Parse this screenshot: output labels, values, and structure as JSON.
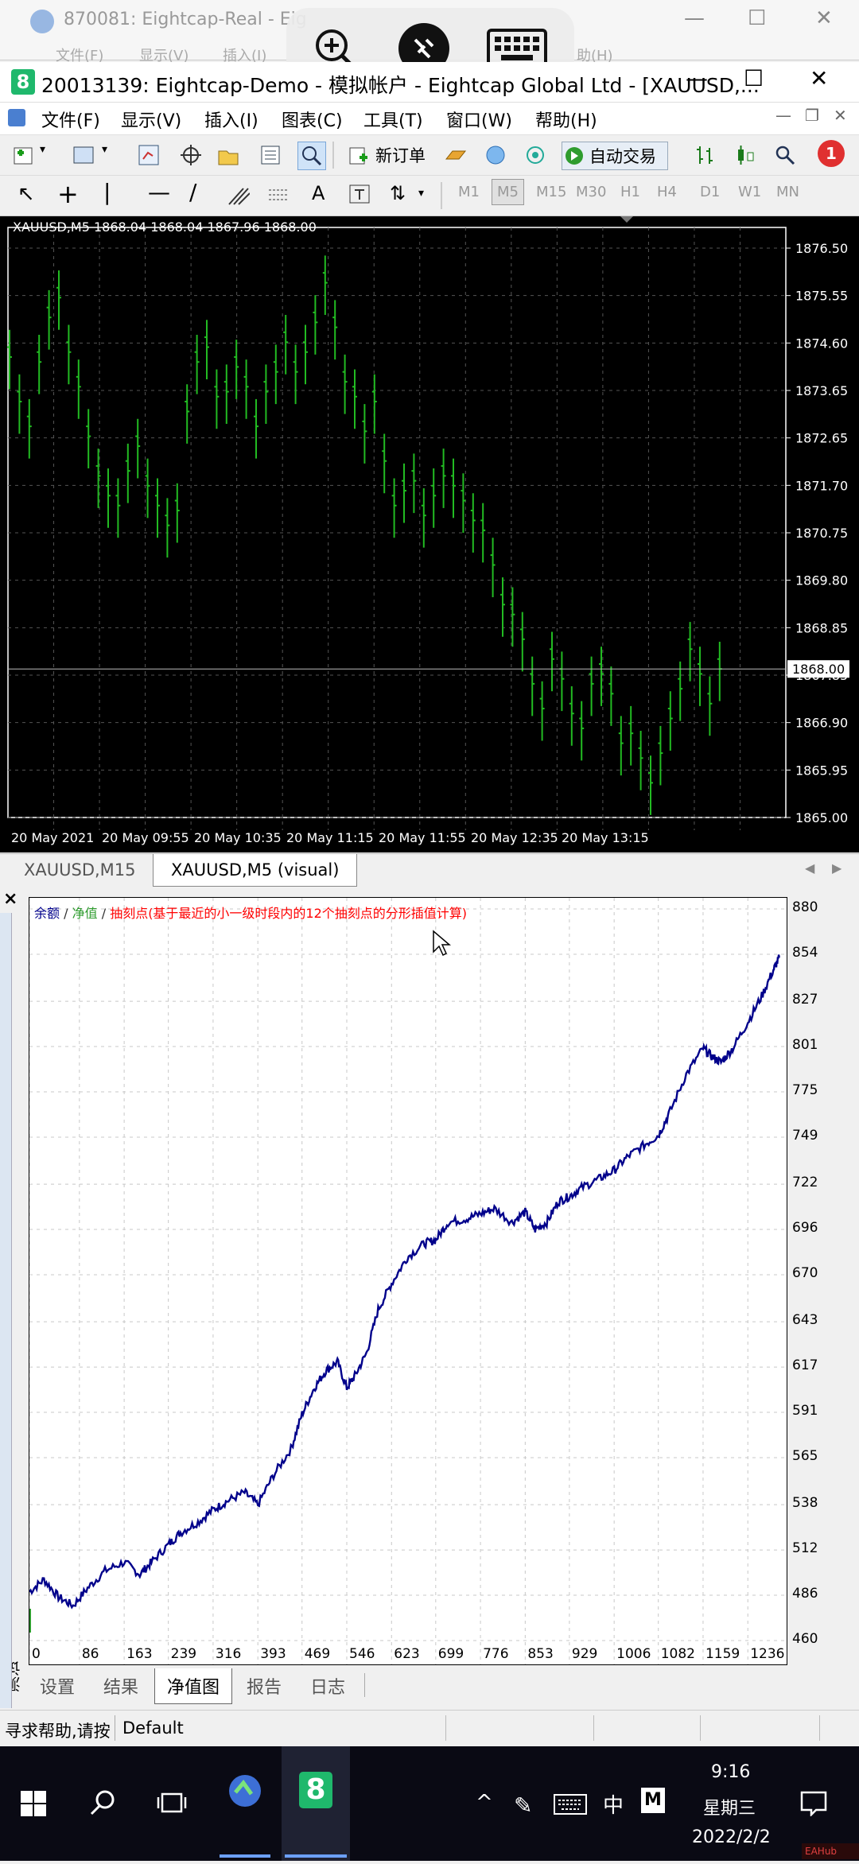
{
  "background_window": {
    "title": "870081: Eightcap-Real - Eig",
    "menu_partial": [
      "文件(F)",
      "显示(V)",
      "插入(I)",
      "助(H)"
    ]
  },
  "window": {
    "title": "20013139: Eightcap-Demo - 模拟帐户 - Eightcap Global Ltd - [XAUUSD,..."
  },
  "menu": [
    "文件(F)",
    "显示(V)",
    "插入(I)",
    "图表(C)",
    "工具(T)",
    "窗口(W)",
    "帮助(H)"
  ],
  "toolbar": {
    "new_order": "新订单",
    "auto_trading": "自动交易",
    "alert_count": "1"
  },
  "timeframes": [
    "M1",
    "M5",
    "M15",
    "M30",
    "H1",
    "H4",
    "D1",
    "W1",
    "MN"
  ],
  "price_chart": {
    "info": "XAUUSD,M5  1868.04 1868.04 1867.96 1868.00",
    "current_price": "1868.00",
    "price_labels": [
      "1876.50",
      "1875.55",
      "1874.60",
      "1873.65",
      "1872.65",
      "1871.70",
      "1870.75",
      "1869.80",
      "1868.85",
      "1867.85",
      "1866.90",
      "1865.95",
      "1865.00"
    ],
    "time_labels": [
      "20 May 2021",
      "20 May 09:55",
      "20 May 10:35",
      "20 May 11:15",
      "20 May 11:55",
      "20 May 12:35",
      "20 May 13:15"
    ],
    "colors": {
      "background": "#000000",
      "candle": "#22bb22",
      "grid": "#555555"
    }
  },
  "chart_tabs": [
    {
      "label": "XAUUSD,M15",
      "active": false
    },
    {
      "label": "XAUUSD,M5 (visual)",
      "active": true
    }
  ],
  "chart_data": {
    "type": "line",
    "legend": {
      "balance": "余额",
      "equity": "净值",
      "ticks": "抽刻点(基于最近的小一级时段内的12个抽刻点的分形插值计算)"
    },
    "x_ticks": [
      "0",
      "86",
      "163",
      "239",
      "316",
      "393",
      "469",
      "546",
      "623",
      "699",
      "776",
      "853",
      "929",
      "1006",
      "1082",
      "1159",
      "1236"
    ],
    "y_ticks": [
      "880",
      "854",
      "827",
      "801",
      "775",
      "749",
      "722",
      "696",
      "670",
      "643",
      "617",
      "591",
      "565",
      "538",
      "512",
      "486",
      "460"
    ],
    "xlim": [
      0,
      1300
    ],
    "ylim": [
      460,
      880
    ],
    "series": [
      {
        "x": [
          0,
          25,
          50,
          75,
          100,
          130,
          163,
          190,
          210,
          239,
          260,
          290,
          316,
          340,
          370,
          393,
          420,
          450,
          469,
          490,
          510,
          530,
          546,
          560,
          580,
          600,
          623,
          650,
          680,
          699,
          720,
          750,
          776,
          800,
          830,
          853,
          870,
          890,
          910,
          929,
          950,
          980,
          1006,
          1030,
          1060,
          1082,
          1100,
          1130,
          1159,
          1175,
          1190,
          1210,
          1236,
          1260,
          1280,
          1290
        ],
        "y": [
          488,
          495,
          485,
          480,
          490,
          500,
          505,
          498,
          505,
          515,
          522,
          528,
          535,
          540,
          545,
          538,
          555,
          570,
          590,
          605,
          615,
          620,
          605,
          612,
          625,
          650,
          665,
          680,
          688,
          690,
          700,
          702,
          705,
          708,
          700,
          706,
          696,
          700,
          712,
          715,
          720,
          725,
          730,
          738,
          745,
          750,
          762,
          785,
          800,
          795,
          792,
          800,
          815,
          830,
          845,
          852
        ]
      }
    ],
    "colors": {
      "balance": "#00008b",
      "equity": "#2e9c2e",
      "ticks": "#ff0000"
    }
  },
  "tester_tabs": [
    {
      "label": "设置",
      "active": false
    },
    {
      "label": "结果",
      "active": false
    },
    {
      "label": "净值图",
      "active": true
    },
    {
      "label": "报告",
      "active": false
    },
    {
      "label": "日志",
      "active": false
    }
  ],
  "tester_side_label": "测试",
  "status": {
    "help": "寻求帮助,请按",
    "profile": "Default"
  },
  "taskbar": {
    "time": "9:16",
    "weekday": "星期三",
    "date": "2022/2/2",
    "ime": "中",
    "ime_mode": "M"
  },
  "watermark": "EAHub"
}
